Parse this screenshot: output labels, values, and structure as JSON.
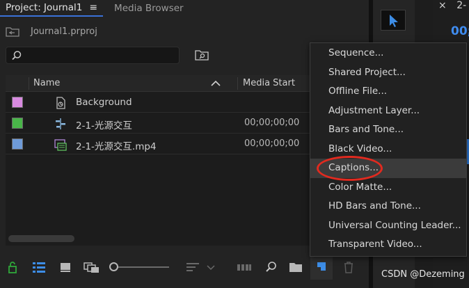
{
  "tabs": {
    "project": "Project: Journal1",
    "project_menu_glyph": "≡",
    "media_browser": "Media Browser"
  },
  "project_file": "Journal1.prproj",
  "search": {
    "value": "",
    "placeholder": ""
  },
  "columns": {
    "name": "Name",
    "media_start": "Media Start"
  },
  "rows": [
    {
      "name": "Background",
      "media_start": "",
      "color": "#d88ae0",
      "icon": "graphic-icon"
    },
    {
      "name": "2-1-光源交互",
      "media_start": "00;00;00;00",
      "color": "#49b549",
      "icon": "sequence-icon"
    },
    {
      "name": "2-1-光源交互.mp4",
      "media_start": "00;00;00;00",
      "color": "#6f9bd8",
      "icon": "video-clip-icon"
    }
  ],
  "menu": {
    "items": [
      "Sequence...",
      "Shared Project...",
      "Offline File...",
      "Adjustment Layer...",
      "Bars and Tone...",
      "Black Video...",
      "Captions...",
      "Color Matte...",
      "HD Bars and Tone...",
      "Universal Counting Leader...",
      "Transparent Video..."
    ],
    "highlighted": "Captions..."
  },
  "right_panel": {
    "tab": "2-",
    "close_glyph": "×",
    "timecode": "00;"
  },
  "watermark": "CSDN @Dezeming",
  "colors": {
    "accent": "#3a72d8",
    "highlight_oval": "#e12a1f",
    "lock_green": "#2fa83a"
  }
}
